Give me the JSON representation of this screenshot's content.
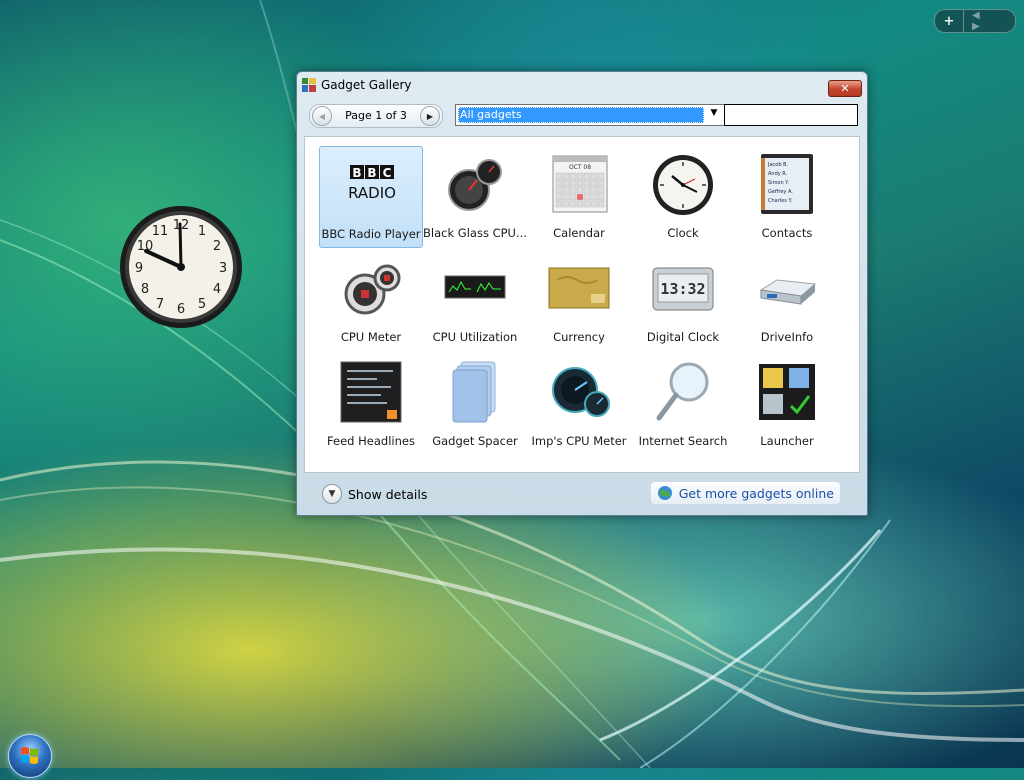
{
  "window": {
    "title": "Gadget Gallery",
    "close_label": "✕"
  },
  "toolbar": {
    "page_label": "Page 1 of 3",
    "prev_icon": "◀",
    "next_icon": "▶",
    "filter_value": "All gadgets",
    "dropdown_icon": "▼",
    "search_value": ""
  },
  "gadgets": [
    {
      "label": "BBC Radio Player",
      "icon": "bbc-radio-icon",
      "selected": true
    },
    {
      "label": "Black Glass CPU...",
      "icon": "black-glass-cpu-icon"
    },
    {
      "label": "Calendar",
      "icon": "calendar-icon"
    },
    {
      "label": "Clock",
      "icon": "clock-icon"
    },
    {
      "label": "Contacts",
      "icon": "contacts-icon"
    },
    {
      "label": "CPU Meter",
      "icon": "cpu-meter-icon"
    },
    {
      "label": "CPU Utilization",
      "icon": "cpu-utilization-icon"
    },
    {
      "label": "Currency",
      "icon": "currency-icon"
    },
    {
      "label": "Digital Clock",
      "icon": "digital-clock-icon"
    },
    {
      "label": "DriveInfo",
      "icon": "driveinfo-icon"
    },
    {
      "label": "Feed Headlines",
      "icon": "feed-headlines-icon"
    },
    {
      "label": "Gadget Spacer",
      "icon": "gadget-spacer-icon"
    },
    {
      "label": "Imp's CPU Meter",
      "icon": "imps-cpu-meter-icon"
    },
    {
      "label": "Internet Search",
      "icon": "internet-search-icon"
    },
    {
      "label": "Launcher",
      "icon": "launcher-icon"
    }
  ],
  "thumb_text": {
    "bbc_line1": "BBC",
    "bbc_line2": "RADIO",
    "calendar_month": "OCT 08",
    "digital_time": "13:32",
    "contacts_lines": [
      "Jacob B.",
      "Andy R.",
      "Simon Y.",
      "Geffrey A.",
      "Charles Y."
    ]
  },
  "footer": {
    "details_label": "Show details",
    "online_label": "Get more gadgets online"
  },
  "sidebar": {
    "add_icon": "+",
    "nav_icons": "◀ ▶"
  },
  "colors": {
    "selection": "#3399ff",
    "link": "#1a4fa8",
    "close": "#c2452c"
  }
}
